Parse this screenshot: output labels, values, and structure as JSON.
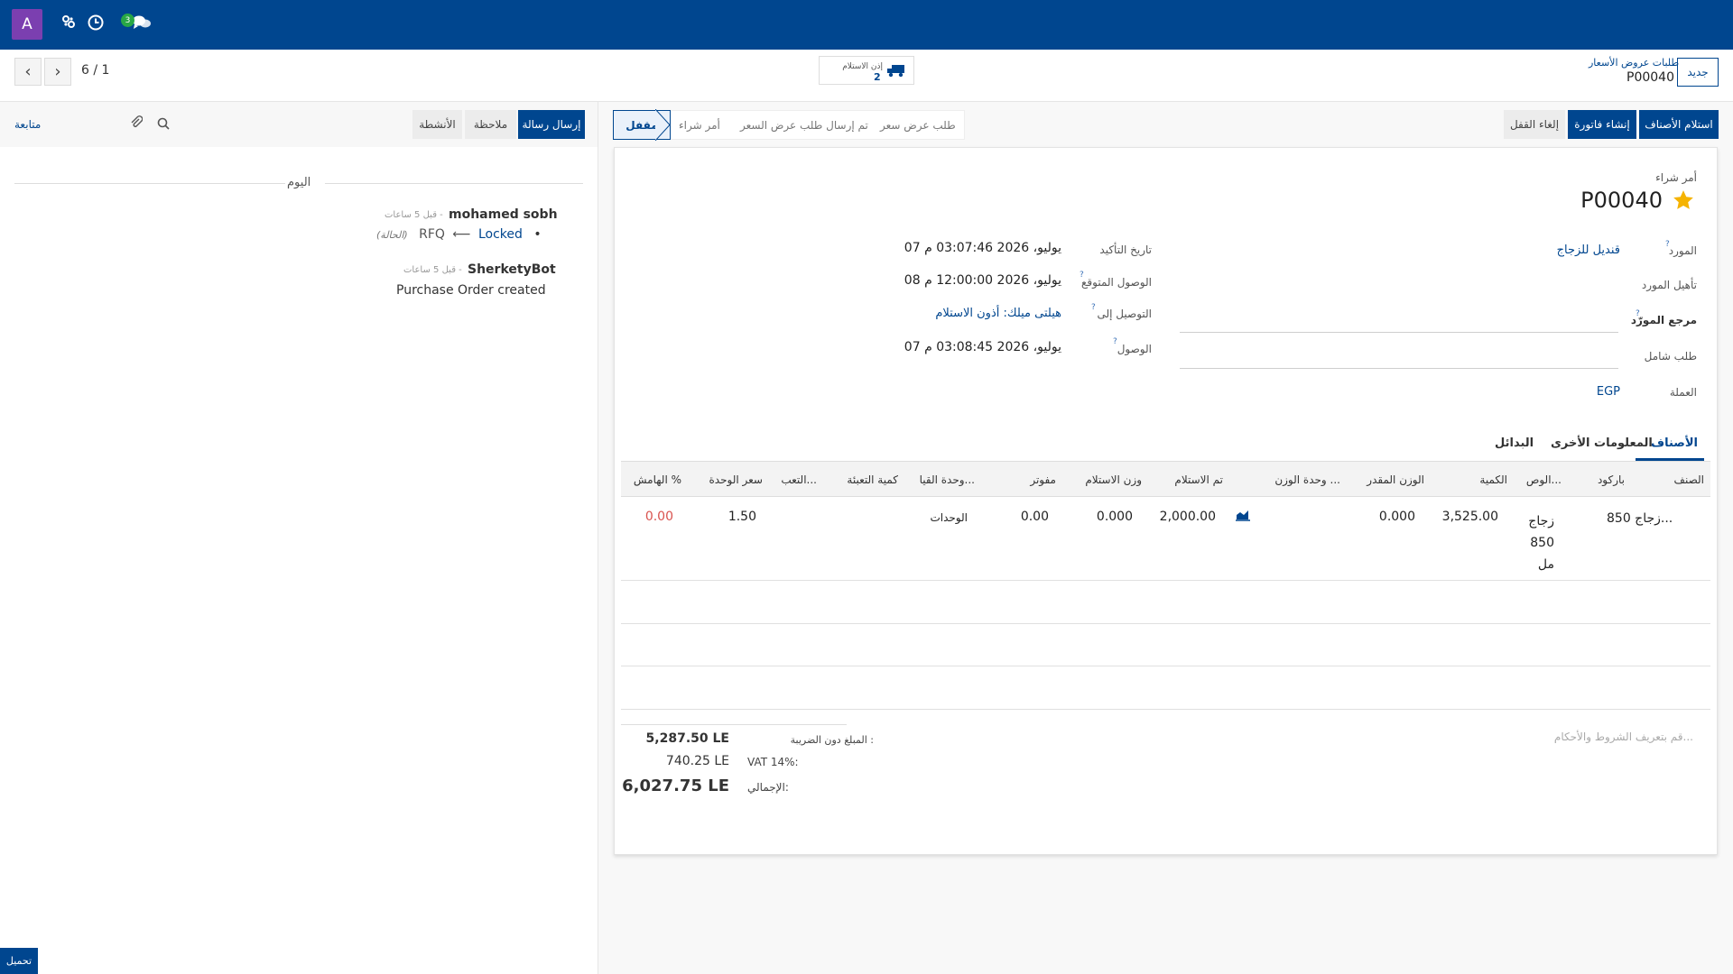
{
  "colors": {
    "primary": "#00468f",
    "avatar": "#7b3fb0",
    "badge": "#28a745",
    "star": "#f5b301",
    "danger": "#d9534f"
  },
  "topbar": {
    "avatar_letter": "A",
    "badge_count": "3",
    "icons": [
      "apps-icon",
      "clock-icon",
      "chat-icon"
    ]
  },
  "breadcrumb": {
    "new_button": "جديد",
    "parent": "طلبات عروض الأسعار",
    "current": "P00040"
  },
  "smart_button": {
    "label": "إذن الاستلام",
    "count": "2"
  },
  "pager": {
    "text": "6 / 1"
  },
  "actions": {
    "receive": "استلام الأصناف",
    "invoice": "إنشاء فاتورة",
    "unlock": "إلغاء القفل"
  },
  "statusbar": {
    "stages": [
      "طلب عرض سعر",
      "تم إرسال طلب عرض السعر",
      "أمر شراء",
      "مقفل"
    ],
    "active": "مقفل"
  },
  "chatter": {
    "send_message": "إرسال رسالة",
    "log_note": "ملاحظة",
    "activities": "الأنشطة",
    "follow": "متابعة",
    "today": "اليوم",
    "messages": [
      {
        "author": "mohamed sobh",
        "time": "قبل 5 ساعات -",
        "old": "RFQ",
        "arrow": "⟵",
        "new": "Locked",
        "field": "(الحالة)"
      },
      {
        "author": "SherketyBot",
        "time": "قبل 5 ساعات -",
        "body": "Purchase Order created"
      }
    ],
    "upload": "تحميل"
  },
  "form": {
    "title_label": "أمر شراء",
    "po_number": "P00040",
    "vendor_label": "المورد",
    "vendor_value": "قنديل للزجاج",
    "vendor_qual_label": "تأهيل المورد",
    "vendor_ref_label": "مرجع المورّد",
    "blanket_label": "طلب شامل",
    "currency_label": "العملة",
    "currency_value": "EGP",
    "confirm_date_label": "تاريخ التأكيد",
    "confirm_date_value": "07 يوليو، 2026 03:07:46 م",
    "expected_arrival_label": "الوصول المتوقع",
    "expected_arrival_value": "08 يوليو، 2026 12:00:00 م",
    "deliver_to_label": "التوصيل إلى",
    "deliver_to_value": "هيلتى ميلك: أذون الاستلام",
    "arrival_label": "الوصول",
    "arrival_value": "07 يوليو، 2026 03:08:45 م"
  },
  "tabs": [
    "الأصناف",
    "المعلومات الأخرى",
    "البدائل"
  ],
  "table": {
    "headers": [
      "الصنف",
      "باركود",
      "الوص...",
      "الكمية",
      "الوزن المقدر",
      "وحدة الوزن ...",
      "تم الاستلام",
      "وزن الاستلام",
      "مفوتر",
      "وحدة القيا...",
      "كمية التعبئة",
      "التعب...",
      "سعر الوحدة",
      "الهامش %"
    ],
    "row": {
      "product": "زجاج 850...",
      "description": "زجاج 850 مل",
      "quantity": "3,525.00",
      "est_weight": "0.000",
      "received": "2,000.00",
      "received_weight": "0.000",
      "billed": "0.00",
      "uom": "الوحدات",
      "unit_price": "1.50",
      "margin": "0.00"
    }
  },
  "terms_placeholder": "قم بتعريف الشروط والأحكام...",
  "totals": {
    "untaxed_label": "المبلغ دون الضريبة :",
    "untaxed_value": "5,287.50 LE",
    "vat_label": "VAT 14%:",
    "vat_value": "740.25 LE",
    "total_label": "الإجمالي:",
    "total_value": "6,027.75 LE"
  }
}
